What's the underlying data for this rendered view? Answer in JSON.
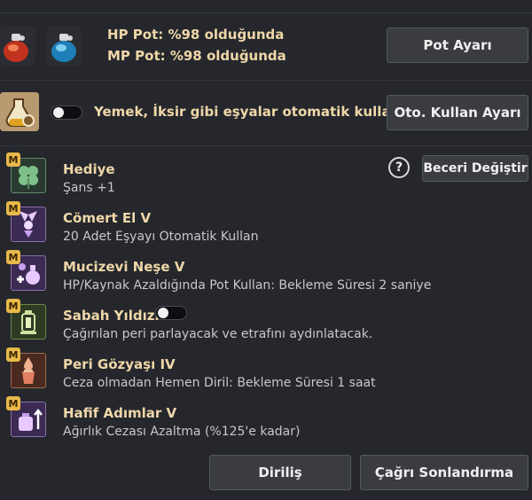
{
  "potions": {
    "hp_text": "HP Pot: %98 olduğunda",
    "mp_text": "MP Pot: %98 olduğunda",
    "settings_button": "Pot Ayarı"
  },
  "food": {
    "text": "Yemek, İksir gibi eşyalar otomatik kullanılır.",
    "toggle_on": false,
    "settings_button": "Oto. Kullan Ayarı"
  },
  "skills_header": {
    "help_icon": "?",
    "change_button": "Beceri Değiştir"
  },
  "skills": [
    {
      "badge": "M",
      "title": "Hediye",
      "desc": "Şans +1",
      "icon": "clover-icon"
    },
    {
      "badge": "M",
      "title": "Cömert El V",
      "desc": "20 Adet Eşyayı Otomatik Kullan",
      "icon": "fairy-icon"
    },
    {
      "badge": "M",
      "title": "Mucizevi Neşe V",
      "desc": "HP/Kaynak Azaldığında Pot Kullan: Bekleme Süresi 2 saniye",
      "icon": "potion-plus-icon"
    },
    {
      "badge": "M",
      "title": "Sabah Yıldızı",
      "desc": "Çağırılan peri parlayacak ve etrafını aydınlatacak.",
      "icon": "lantern-icon",
      "toggle_on": false
    },
    {
      "badge": "M",
      "title": "Peri Gözyaşı IV",
      "desc": "Ceza olmadan Hemen Diril: Bekleme Süresi 1 saat",
      "icon": "tear-vase-icon"
    },
    {
      "badge": "M",
      "title": "Hafif Adımlar V",
      "desc": "Ağırlık Cezası Azaltma (%125'e kadar)",
      "icon": "weight-up-icon"
    }
  ],
  "footer": {
    "revive_button": "Diriliş",
    "end_summon_button": "Çağrı Sonlandırma"
  }
}
